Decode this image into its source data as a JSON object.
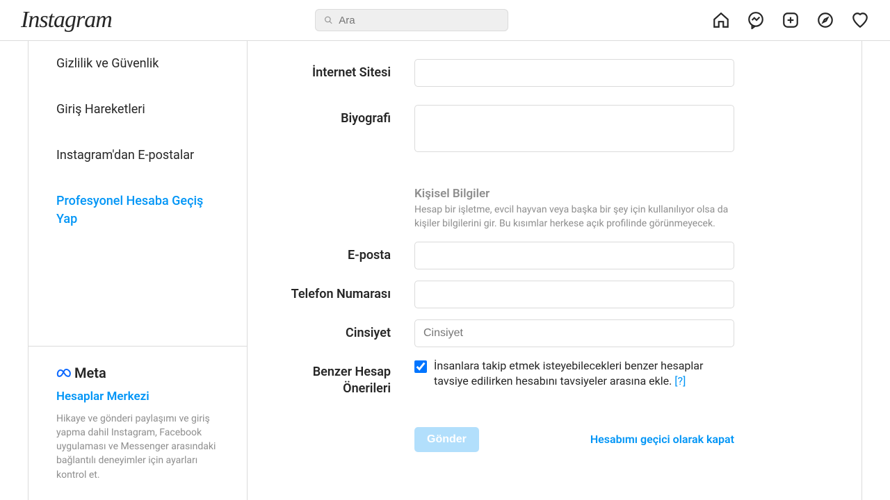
{
  "header": {
    "logo": "Instagram",
    "search_placeholder": "Ara"
  },
  "sidebar": {
    "items": [
      "Gizlilik ve Güvenlik",
      "Giriş Hareketleri",
      "Instagram'dan E-postalar",
      "Profesyonel Hesaba Geçiş Yap"
    ],
    "meta": {
      "brand": "Meta",
      "title": "Hesaplar Merkezi",
      "desc": "Hikaye ve gönderi paylaşımı ve giriş yapma dahil Instagram, Facebook uygulaması ve Messenger arasındaki bağlantılı deneyimler için ayarları kontrol et."
    }
  },
  "form": {
    "website_label": "İnternet Sitesi",
    "bio_label": "Biyografi",
    "personal": {
      "title": "Kişisel Bilgiler",
      "desc": "Hesap bir işletme, evcil hayvan veya başka bir şey için kullanılıyor olsa da kişiler bilgilerini gir. Bu kısımlar herkese açık profilinde görünmeyecek."
    },
    "email_label": "E-posta",
    "phone_label": "Telefon Numarası",
    "gender_label": "Cinsiyet",
    "gender_placeholder": "Cinsiyet",
    "similar_label": "Benzer Hesap Önerileri",
    "similar_text": "İnsanlara takip etmek isteyebilecekleri benzer hesaplar tavsiye edilirken hesabını tavsiyeler arasına ekle.",
    "similar_help": "[?]",
    "submit": "Gönder",
    "disable": "Hesabımı geçici olarak kapat"
  }
}
